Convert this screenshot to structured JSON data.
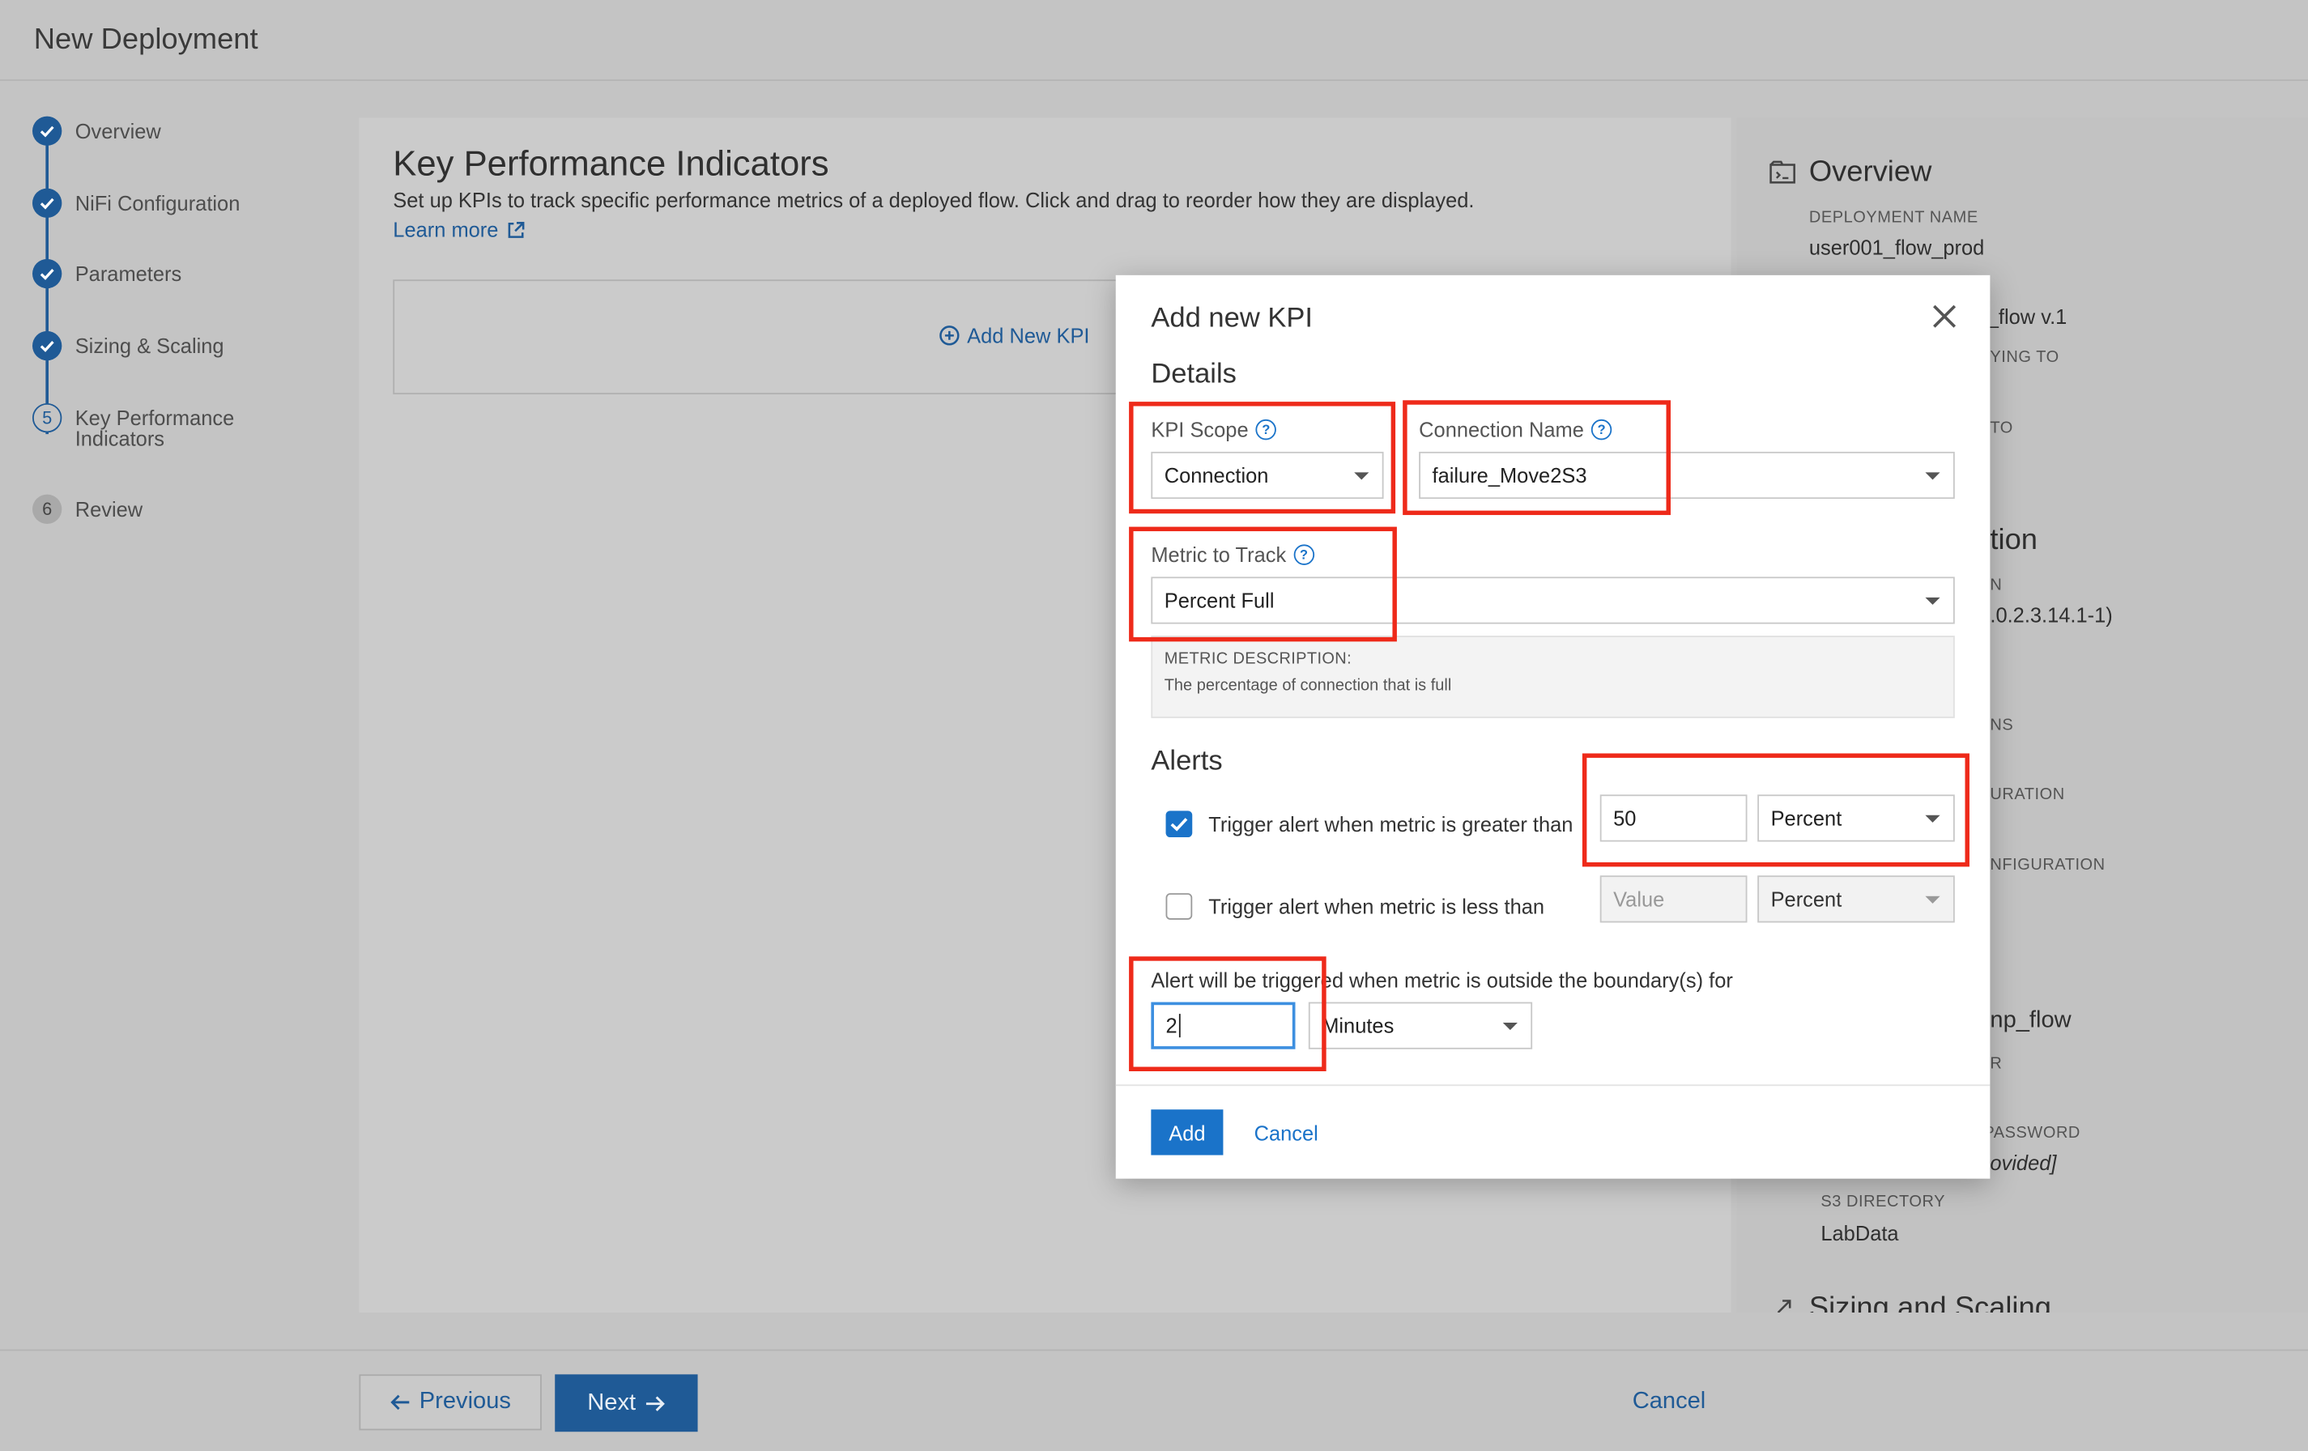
{
  "app": {
    "title": "New Deployment"
  },
  "steps": [
    {
      "label": "Overview",
      "status": "done"
    },
    {
      "label": "NiFi Configuration",
      "status": "done"
    },
    {
      "label": "Parameters",
      "status": "done"
    },
    {
      "label": "Sizing & Scaling",
      "status": "done"
    },
    {
      "number": "5",
      "label_line1": "Key Performance",
      "label_line2": "Indicators",
      "status": "current"
    },
    {
      "number": "6",
      "label": "Review",
      "status": "todo"
    }
  ],
  "main": {
    "title": "Key Performance Indicators",
    "subtitle": "Set up KPIs to track specific performance metrics of a deployed flow. Click and drag to reorder how they are displayed.",
    "learn_more": "Learn more",
    "add_kpi": "Add New KPI"
  },
  "overview": {
    "title": "Overview",
    "deployment_name_label": "DEPLOYMENT NAME",
    "deployment_name": "user001_flow_prod",
    "flow_fragment": "_flow v.1",
    "deploying_to_fragment": "YING TO",
    "to_fragment": "TO",
    "section_fragment": "tion",
    "n_fragment": "N",
    "version_fragment": ".0.2.3.14.1-1)",
    "ns_fragment": "NS",
    "uration_fragment": "URATION",
    "nfiguration_fragment": "NFIGURATION",
    "np_flow_fragment": "np_flow",
    "r_fragment": "R",
    "password_fragment": "R PASSWORD",
    "provided_fragment": "ovided]",
    "s3_label": "S3 DIRECTORY",
    "s3_value": "LabData",
    "sizing_fragment": "Sizing and Scaling"
  },
  "footer": {
    "previous": "Previous",
    "next": "Next",
    "cancel": "Cancel"
  },
  "modal": {
    "title": "Add new KPI",
    "details": "Details",
    "kpi_scope_label": "KPI Scope",
    "kpi_scope_value": "Connection",
    "connection_name_label": "Connection Name",
    "connection_name_value": "failure_Move2S3",
    "metric_label": "Metric to Track",
    "metric_value": "Percent Full",
    "metric_desc_heading": "METRIC DESCRIPTION:",
    "metric_desc": "The percentage of connection that is full",
    "alerts": "Alerts",
    "greater_label": "Trigger alert when metric is greater than",
    "greater_checked": true,
    "greater_value": "50",
    "greater_unit": "Percent",
    "less_label": "Trigger alert when metric is less than",
    "less_checked": false,
    "less_placeholder": "Value",
    "less_unit": "Percent",
    "boundary_text": "Alert will be triggered when metric is outside the boundary(s) for",
    "duration_value": "2",
    "duration_unit": "Minutes",
    "add": "Add",
    "cancel": "Cancel"
  },
  "colors": {
    "accent": "#1a73c9",
    "highlight": "#ee2a1a",
    "nav_blue": "#1f5a96"
  }
}
